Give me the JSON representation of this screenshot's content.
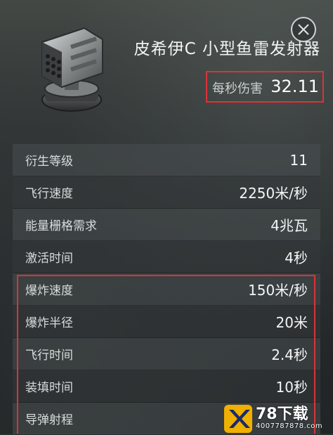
{
  "item": {
    "name": "皮希伊C 小型鱼雷发射器",
    "icon": "torpedo-launcher-icon"
  },
  "damage": {
    "label": "每秒伤害",
    "value": "32.11"
  },
  "stats": [
    {
      "label": "衍生等级",
      "value": "11"
    },
    {
      "label": "飞行速度",
      "value": "2250米/秒"
    },
    {
      "label": "能量栅格需求",
      "value": "4兆瓦"
    },
    {
      "label": "激活时间",
      "value": "4秒"
    },
    {
      "label": "爆炸速度",
      "value": "150米/秒"
    },
    {
      "label": "爆炸半径",
      "value": "20米"
    },
    {
      "label": "飞行时间",
      "value": "2.4秒"
    },
    {
      "label": "装填时间",
      "value": "10秒"
    },
    {
      "label": "导弹射程",
      "value": ""
    }
  ],
  "watermark": {
    "title": "78下载",
    "url": "4007787878.com"
  },
  "colors": {
    "highlight": "#d9343a",
    "watermark_logo": "#f0b000"
  }
}
